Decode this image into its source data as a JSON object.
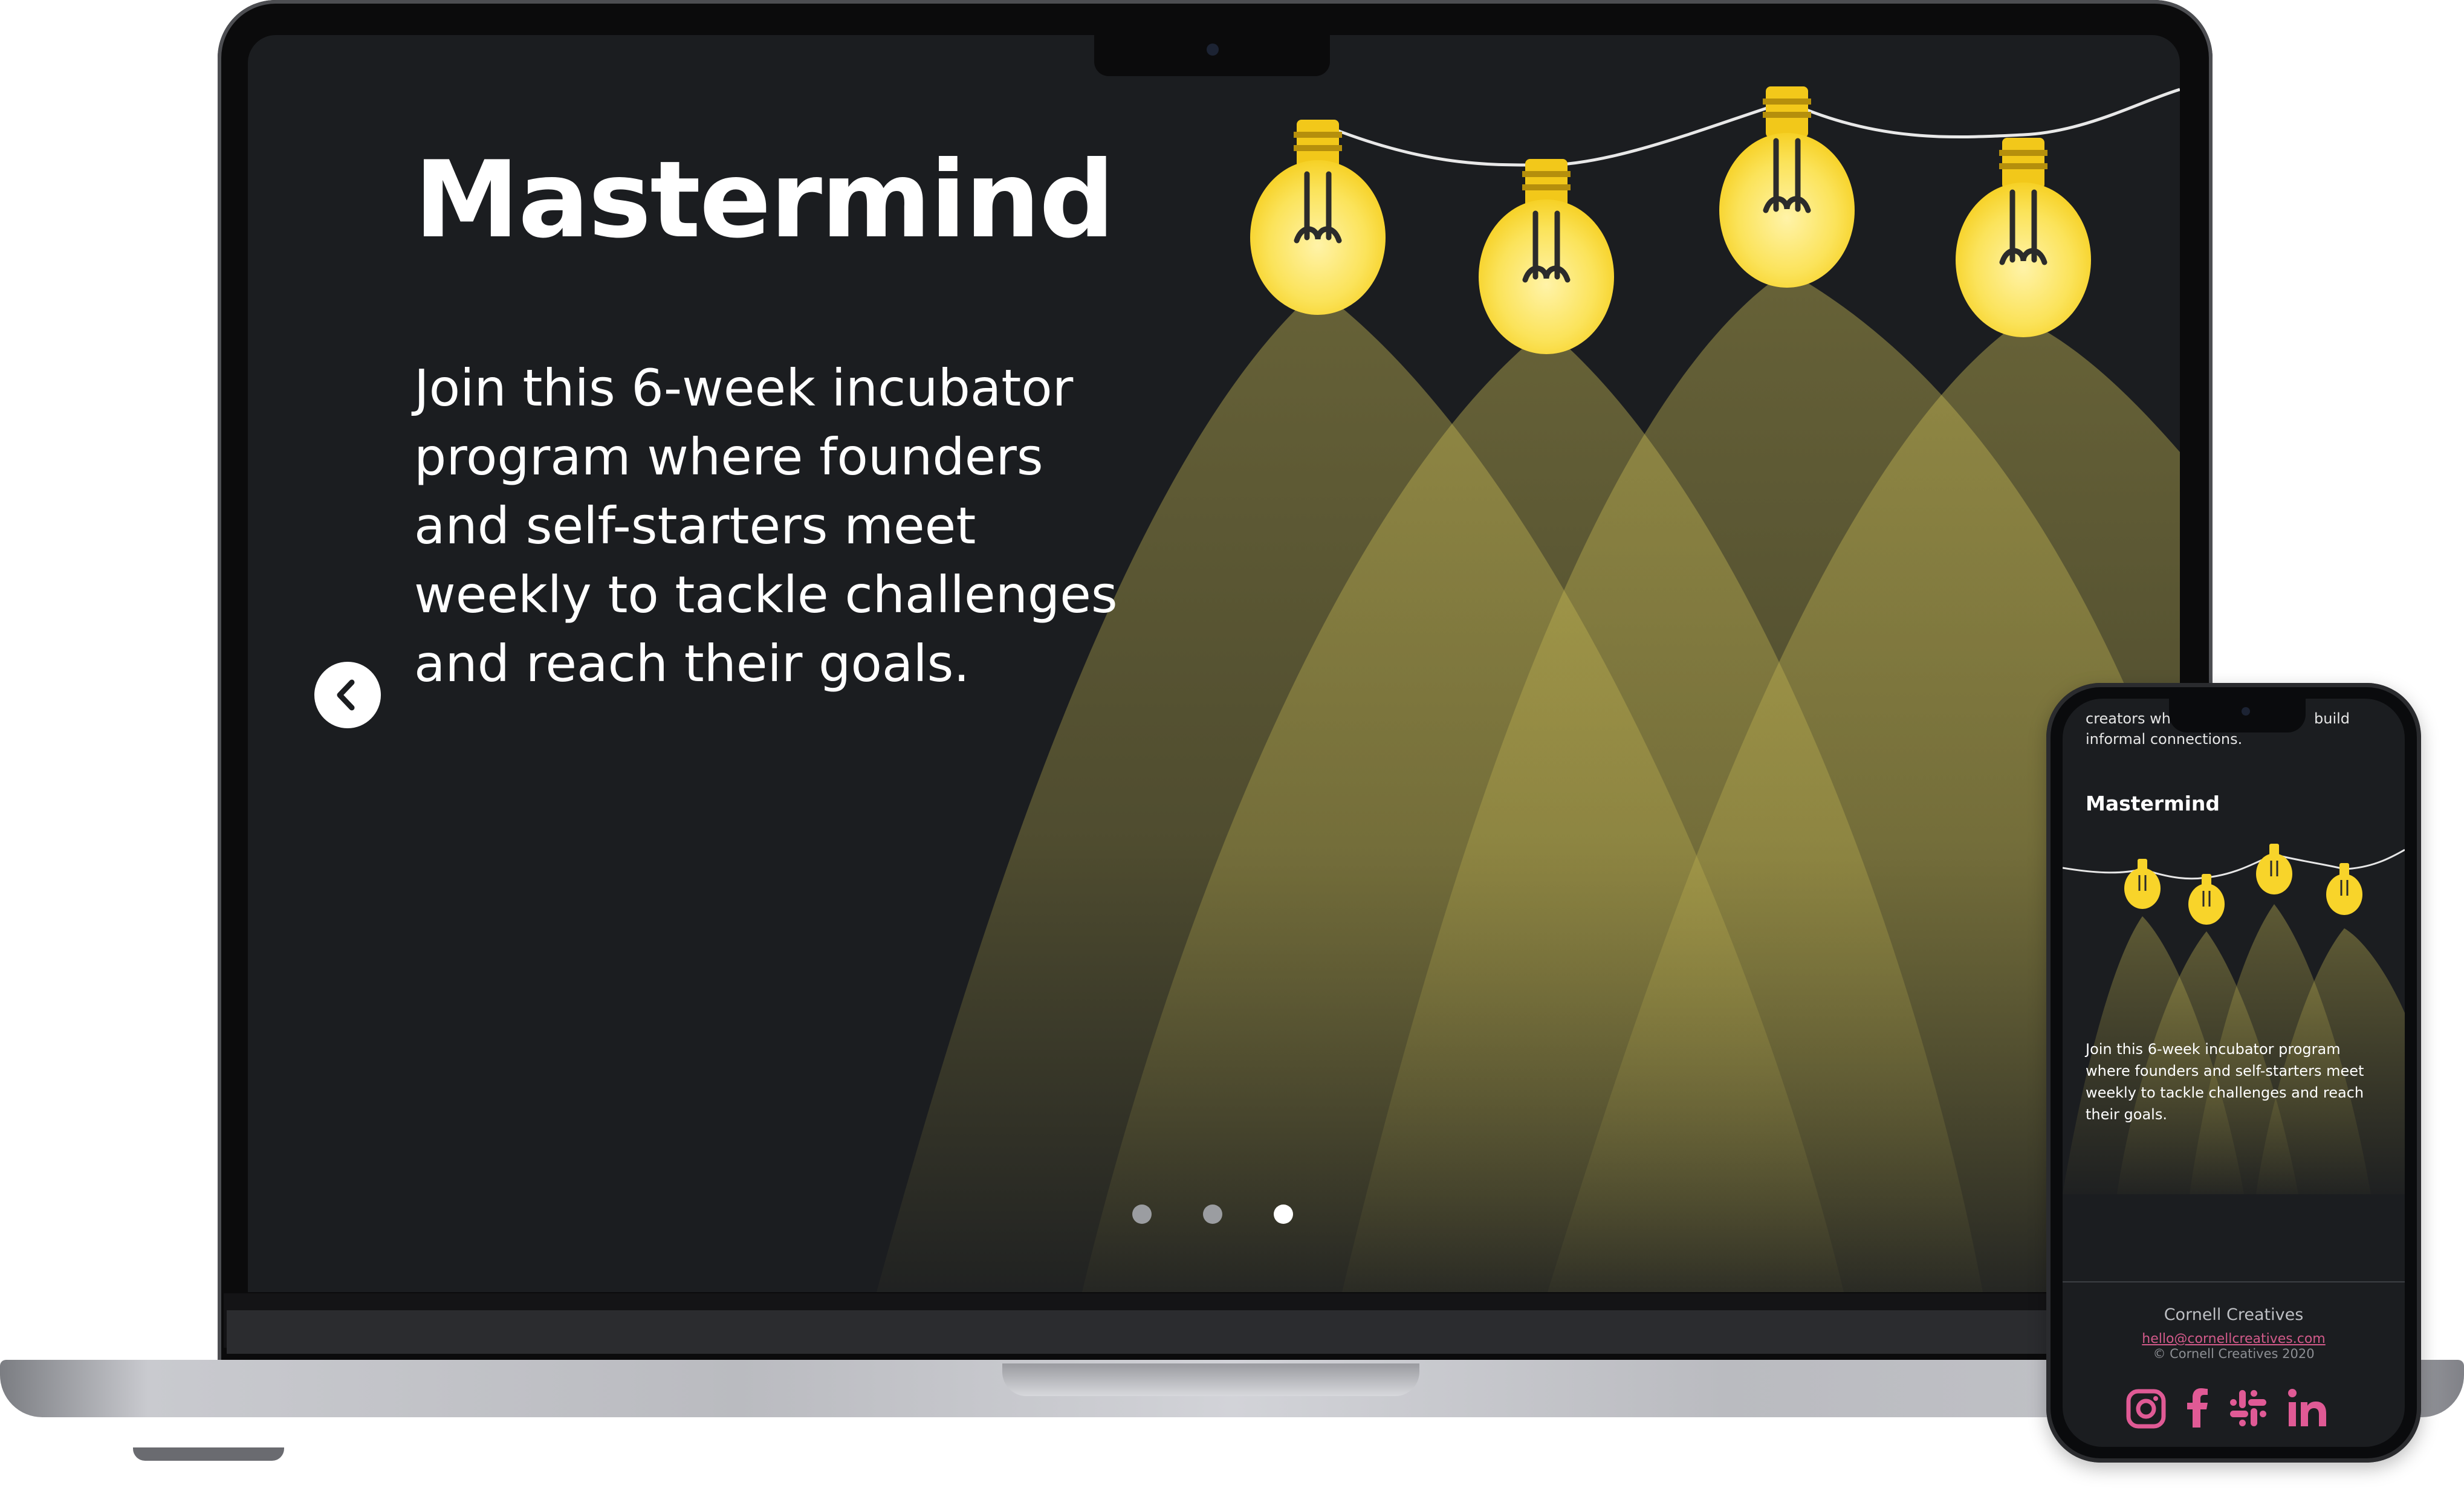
{
  "laptop": {
    "slide": {
      "title": "Mastermind",
      "body": "Join this 6-week incubator program where founders and self-starters meet weekly to tackle challenges and reach their goals."
    },
    "carousel": {
      "slide_count": 3,
      "active_index": 2
    }
  },
  "phone": {
    "previous_text_line1": "creators wh",
    "previous_text_line1_end": "build",
    "previous_text_line2": "informal connections.",
    "title": "Mastermind",
    "body": "Join this 6-week incubator program where founders and self-starters meet weekly to tackle challenges and reach their goals.",
    "footer": {
      "brand": "Cornell Creatives",
      "email": "hello@cornellcreatives.com",
      "copyright": "© Cornell Creatives 2020",
      "social": [
        "instagram-icon",
        "facebook-icon",
        "slack-icon",
        "linkedin-icon"
      ]
    }
  },
  "colors": {
    "background": "#1b1d20",
    "bulb": "#f8d42a",
    "bulb_band": "#d6ac14",
    "light_beam": "#b8a94a",
    "social_pink": "#e05a95"
  }
}
